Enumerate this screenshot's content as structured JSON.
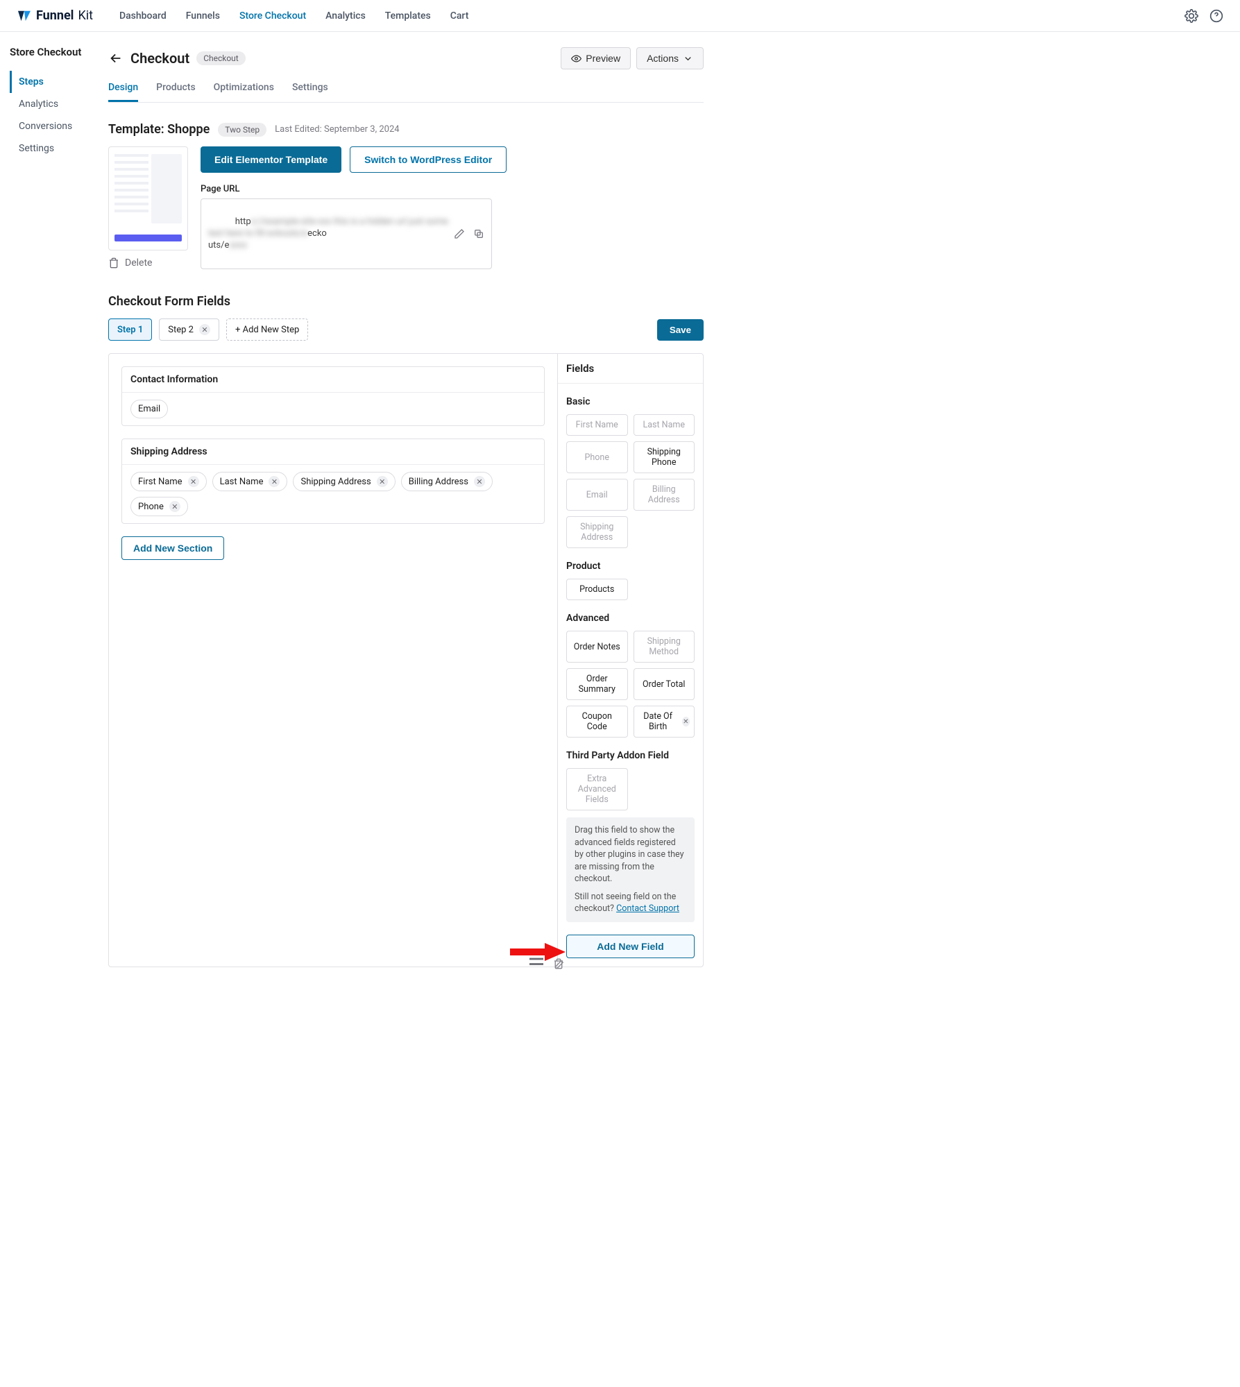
{
  "brand": {
    "name1": "Funnel",
    "name2": "Kit"
  },
  "topnav": {
    "dashboard": "Dashboard",
    "funnels": "Funnels",
    "store_checkout": "Store Checkout",
    "analytics": "Analytics",
    "templates": "Templates",
    "cart": "Cart"
  },
  "sidebar": {
    "title": "Store Checkout",
    "items": [
      "Steps",
      "Analytics",
      "Conversions",
      "Settings"
    ]
  },
  "header": {
    "title": "Checkout",
    "chip": "Checkout",
    "preview": "Preview",
    "actions": "Actions"
  },
  "tabs": {
    "design": "Design",
    "products": "Products",
    "optimizations": "Optimizations",
    "settings": "Settings"
  },
  "template": {
    "title": "Template: Shoppe",
    "badge": "Two Step",
    "last_edited": "Last Edited: September 3, 2024",
    "edit_btn": "Edit Elementor Template",
    "switch_btn": "Switch to WordPress Editor",
    "url_label": "Page URL",
    "url_prefix": "http",
    "url_blur": "s://example-site-xxx this is a hidden url just some text here to fill eckouts/e",
    "url_suffix1": "ecko",
    "url_suffix2": "uts/e",
    "delete": "Delete"
  },
  "form": {
    "section_title": "Checkout Form Fields",
    "steps": {
      "s1": "Step 1",
      "s2": "Step 2",
      "add": "+ Add New Step"
    },
    "save": "Save",
    "sections": [
      {
        "title": "Contact Information",
        "fields": [
          "Email"
        ]
      },
      {
        "title": "Shipping Address",
        "fields": [
          "First Name",
          "Last Name",
          "Shipping Address",
          "Billing Address",
          "Phone"
        ]
      }
    ],
    "add_section": "Add New Section"
  },
  "panel": {
    "title": "Fields",
    "basic_h": "Basic",
    "basic": [
      {
        "l": "First Name",
        "dim": true
      },
      {
        "l": "Last Name",
        "dim": true
      },
      {
        "l": "Phone",
        "dim": true
      },
      {
        "l": "Shipping Phone",
        "dim": false
      },
      {
        "l": "Email",
        "dim": true
      },
      {
        "l": "Billing Address",
        "dim": true
      },
      {
        "l": "Shipping Address",
        "dim": true
      }
    ],
    "product_h": "Product",
    "product": [
      {
        "l": "Products",
        "dim": false
      }
    ],
    "advanced_h": "Advanced",
    "advanced": [
      {
        "l": "Order Notes",
        "dim": false
      },
      {
        "l": "Shipping Method",
        "dim": true
      },
      {
        "l": "Order Summary",
        "dim": false
      },
      {
        "l": "Order Total",
        "dim": false
      },
      {
        "l": "Coupon Code",
        "dim": false
      },
      {
        "l": "Date Of Birth",
        "dim": false,
        "x": true
      }
    ],
    "third_h": "Third Party Addon Field",
    "third": [
      {
        "l": "Extra Advanced Fields",
        "dim": true
      }
    ],
    "hint1": "Drag this field to show the advanced fields registered by other plugins in case they are missing from the checkout.",
    "hint2a": "Still not seeing field on the checkout? ",
    "hint2b": "Contact Support",
    "add_field": "Add New Field"
  }
}
